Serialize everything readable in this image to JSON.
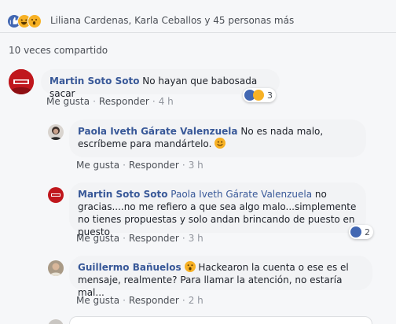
{
  "reactions": {
    "summary": "Liliana Cardenas, Karla Ceballos y 45 personas más",
    "icons": [
      "like-icon",
      "haha-icon",
      "wow-icon"
    ]
  },
  "shares": "10 veces compartido",
  "actions": {
    "like": "Me gusta",
    "reply": "Responder"
  },
  "comments": [
    {
      "author": "Martin Soto Soto",
      "text": "No hayan que babosada sacar",
      "time": "4 h",
      "reaction_count": "3",
      "reactions": [
        "like-icon",
        "haha-icon"
      ]
    },
    {
      "author": "Paola Iveth Gárate Valenzuela",
      "text": "No es nada malo, escríbeme para mandártelo.",
      "time": "3 h",
      "emoji": "smile-emoji"
    },
    {
      "author": "Martin Soto Soto",
      "mention": "Paola Iveth Gárate Valenzuela",
      "text": "no gracias....no me refiero a que sea algo malo...simplemente no tienes propuestas y solo andan brincando de puesto en puesto",
      "time": "3 h",
      "reaction_count": "2",
      "reactions": [
        "like-icon"
      ]
    },
    {
      "author": "Guillermo Bañuelos",
      "emoji": "wow-emoji",
      "text": "Hackearon la cuenta o ese es el mensaje, realmente? Para llamar la atención, no estaría mal...",
      "time": "2 h"
    }
  ],
  "colors": {
    "link": "#385898",
    "like": "#4267b2",
    "emoji": "#f7b125",
    "bubble": "#f2f3f5"
  }
}
